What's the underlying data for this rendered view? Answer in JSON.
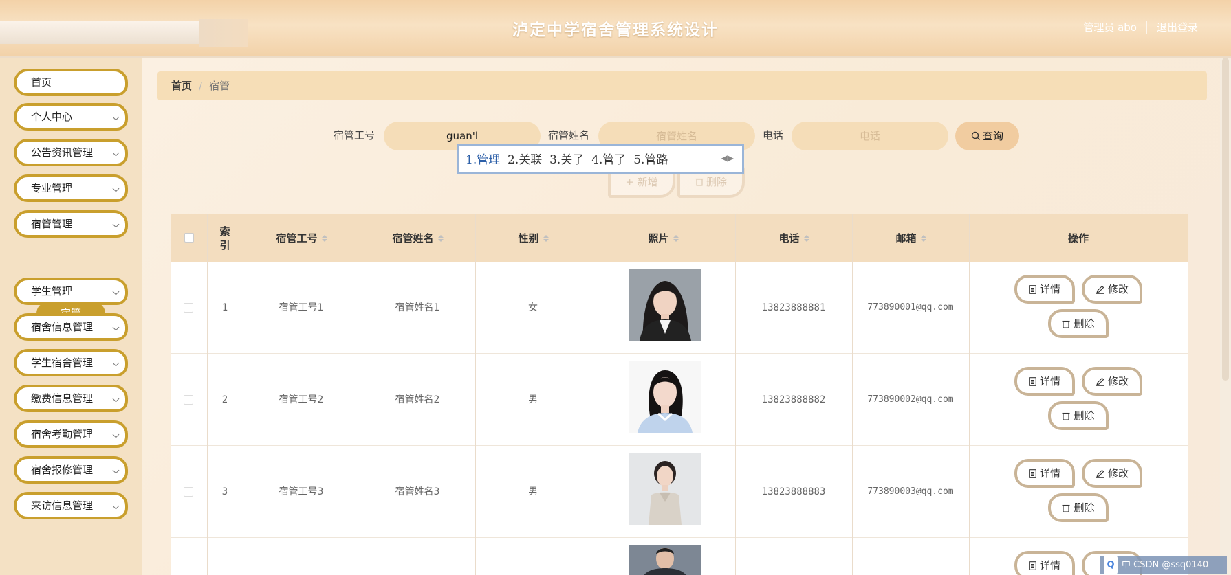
{
  "header": {
    "title": "泸定中学宿舍管理系统设计",
    "role_label": "管理员 abo",
    "logout_label": "退出登录"
  },
  "sidebar": {
    "items": [
      {
        "label": "首页"
      },
      {
        "label": "个人中心"
      },
      {
        "label": "公告资讯管理"
      },
      {
        "label": "专业管理"
      },
      {
        "label": "宿管管理"
      },
      {
        "label": "学生管理"
      },
      {
        "label": "宿舍信息管理"
      },
      {
        "label": "学生宿舍管理"
      },
      {
        "label": "缴费信息管理"
      },
      {
        "label": "宿舍考勤管理"
      },
      {
        "label": "宿舍报修管理"
      },
      {
        "label": "来访信息管理"
      }
    ],
    "active_sub": "宿管"
  },
  "breadcrumb": {
    "home": "首页",
    "current": "宿管"
  },
  "search": {
    "id_label": "宿管工号",
    "id_value": "guan'l",
    "name_label": "宿管姓名",
    "name_placeholder": "宿管姓名",
    "phone_label": "电话",
    "phone_placeholder": "电话",
    "query_label": "查询"
  },
  "ime": {
    "candidates": [
      "1.管理",
      "2.关联",
      "3.关了",
      "4.管了",
      "5.管路"
    ]
  },
  "actions": {
    "add_label": "+ 新增",
    "delete_label": "删除"
  },
  "table": {
    "headers": {
      "index": "索引",
      "id": "宿管工号",
      "name": "宿管姓名",
      "gender": "性别",
      "photo": "照片",
      "phone": "电话",
      "email": "邮箱",
      "ops": "操作"
    },
    "rows": [
      {
        "index": "1",
        "id": "宿管工号1",
        "name": "宿管姓名1",
        "gender": "女",
        "phone": "13823888881",
        "email": "773890001@qq.com"
      },
      {
        "index": "2",
        "id": "宿管工号2",
        "name": "宿管姓名2",
        "gender": "男",
        "phone": "13823888882",
        "email": "773890002@qq.com"
      },
      {
        "index": "3",
        "id": "宿管工号3",
        "name": "宿管姓名3",
        "gender": "男",
        "phone": "13823888883",
        "email": "773890003@qq.com"
      }
    ],
    "row_actions": {
      "detail": "详情",
      "edit": "修改",
      "delete": "删除"
    }
  },
  "tray": {
    "text": "中 CSDN @ssq0140"
  },
  "colors": {
    "accent": "#c99f2d",
    "header_bg": "#f3d2a8",
    "table_head": "#f3ddbf"
  }
}
